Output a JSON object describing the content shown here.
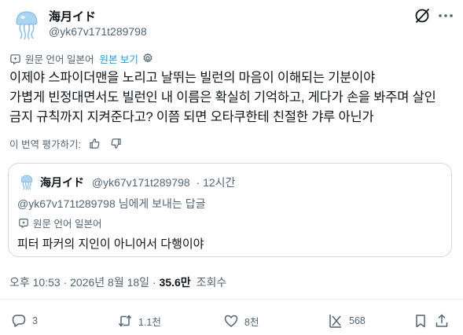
{
  "author": {
    "name": "海月イド",
    "handle": "@yk67v171t289798"
  },
  "translation": {
    "original_language": "원문 언어 일본어",
    "show_original": "원본 보기"
  },
  "post": {
    "lines": [
      "이제야 스파이더맨을 노리고 날뛰는 빌런의 마음이 이해되는 기분이야",
      "가볍게 빈정대면서도 빌런인 내 이름은 확실히 기억하고, 게다가 손을 봐주며 살인",
      "금지 규칙까지 지켜준다고? 이쯤 되면 오타쿠한테 친절한 갸루 아닌가"
    ]
  },
  "rate_translation": "이 번역 평가하기:",
  "quote": {
    "name": "海月イド",
    "handle": "@yk67v171t289798",
    "time": "· 12시간",
    "reply_to": "@yk67v171t289798 님에게 보내는 답글",
    "original_language": "원문 언어 일본어",
    "text": "피터 파커의 지인이 아니어서 다행이야"
  },
  "meta": {
    "time": "오후 10:53",
    "date": "2026년 8월 18일",
    "views_count": "35.6만",
    "views_label": "조회수"
  },
  "actions": {
    "replies": "3",
    "reposts": "1.1천",
    "likes": "8천",
    "views": "568"
  },
  "colors": {
    "text": "#0f1419",
    "secondary": "#536471",
    "accent": "#1d9bf0",
    "border": "#cfd9de"
  },
  "icons": [
    "jellyfish-avatar",
    "grok-icon",
    "more-icon",
    "translate-icon",
    "settings-icon",
    "thumbs-up-icon",
    "thumbs-down-icon",
    "reply-icon",
    "repost-icon",
    "like-icon",
    "views-icon",
    "bookmark-icon",
    "share-icon"
  ]
}
